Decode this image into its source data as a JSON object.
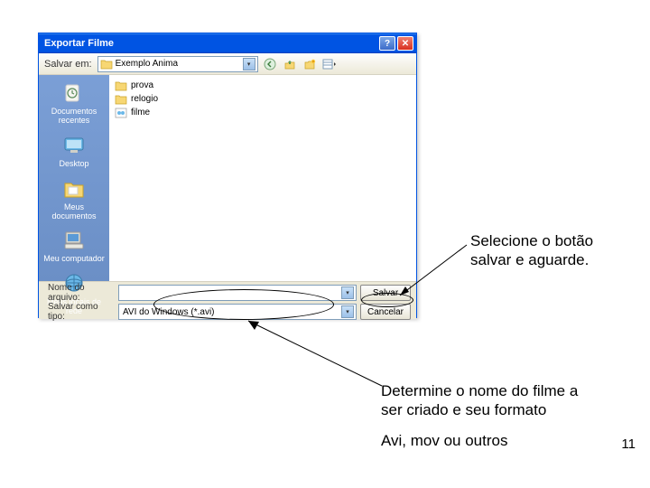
{
  "dialog": {
    "title": "Exportar Filme",
    "save_in_label": "Salvar em:",
    "current_folder": "Exemplo Anima",
    "places": [
      {
        "label": "Documentos recentes",
        "icon": "recent"
      },
      {
        "label": "Desktop",
        "icon": "desktop"
      },
      {
        "label": "Meus documentos",
        "icon": "mydocs"
      },
      {
        "label": "Meu computador",
        "icon": "mycomputer"
      },
      {
        "label": "Meus locais de rede",
        "icon": "network"
      }
    ],
    "files": [
      {
        "name": "prova",
        "type": "folder"
      },
      {
        "name": "relogio",
        "type": "folder"
      },
      {
        "name": "filme",
        "type": "file"
      }
    ],
    "filename_label": "Nome do arquivo:",
    "filename_value": "",
    "filetype_label": "Salvar como tipo:",
    "filetype_value": "AVI do Windows (*.avi)",
    "save_button": "Salvar",
    "cancel_button": "Cancelar"
  },
  "annotations": {
    "save_hint": "Selecione o botão salvar e aguarde.",
    "name_hint_line1": "Determine o nome do filme a ser criado e seu formato",
    "name_hint_line2": "Avi, mov ou outros"
  },
  "page_number": "11"
}
